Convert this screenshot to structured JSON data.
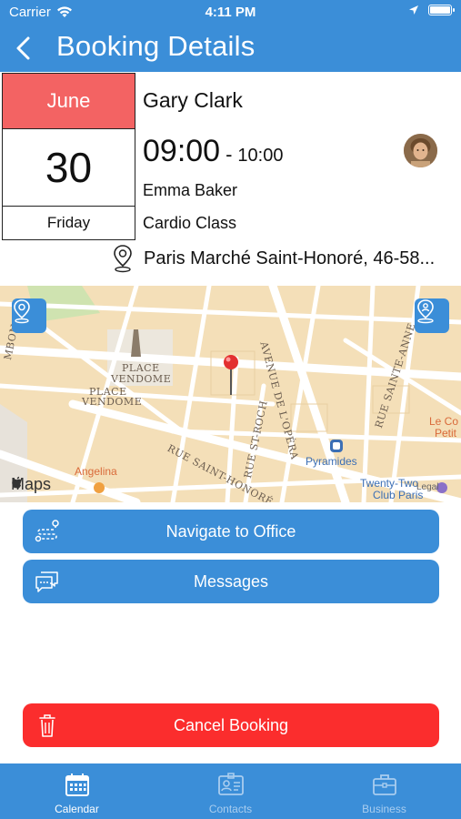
{
  "status_bar": {
    "carrier": "Carrier",
    "time": "4:11 PM",
    "battery_level": 1.0
  },
  "nav": {
    "title": "Booking Details",
    "back_icon": "chevron-left-icon"
  },
  "booking": {
    "month": "June",
    "day": "30",
    "weekday": "Friday",
    "client_name": "Gary Clark",
    "start_time": "09:00",
    "time_separator": "-",
    "end_time": "10:00",
    "staff_name": "Emma Baker",
    "service": "Cardio Class",
    "location": "Paris Marché Saint-Honoré, 46-58..."
  },
  "map": {
    "labels": {
      "place_vendome_1": "PLACE",
      "place_vendome_2": "VENDOME",
      "place_vendome_3": "PLACE",
      "place_vendome_4": "VENDOME",
      "avenue_opera": "AVENUE DE L'OPÉRA",
      "rue_st_roch": "RUE ST-ROCH",
      "rue_saint_honore": "RUE SAINT-HONORÉ",
      "rue_sainte_anne": "RUE SAINTE-ANNE",
      "mbon": "MBON",
      "pyramides": "Pyramides",
      "angelina": "Angelina",
      "twenty_two": "Twenty-Two",
      "club_paris": "Club Paris",
      "le_co": "Le Co",
      "petit": "Petit",
      "maps_logo": "Maps",
      "legal": "Legal"
    }
  },
  "actions": {
    "navigate_label": "Navigate to Office",
    "messages_label": "Messages",
    "cancel_label": "Cancel Booking"
  },
  "tabs": [
    {
      "label": "Calendar",
      "icon": "calendar-icon",
      "active": true
    },
    {
      "label": "Contacts",
      "icon": "contact-card-icon",
      "active": false
    },
    {
      "label": "Business",
      "icon": "briefcase-icon",
      "active": false
    }
  ],
  "colors": {
    "primary": "#3b8ed8",
    "month_header": "#f36363",
    "cancel": "#fb2d2d"
  }
}
